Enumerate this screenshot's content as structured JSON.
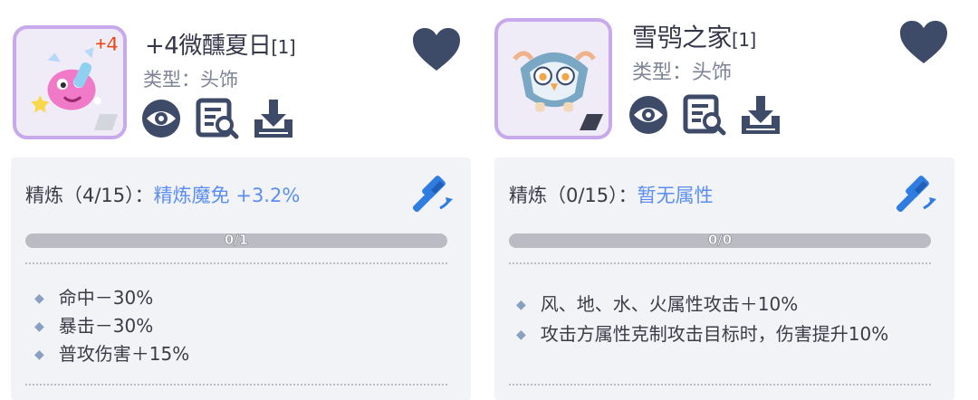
{
  "left": {
    "title": "+4微醺夏日",
    "title_tag": "[1]",
    "plus_badge": "+4",
    "type_line": "类型：头饰",
    "refine_label": "精炼（4/15）：",
    "refine_value": "精炼魔免 +3.2%",
    "progress_text": "0/1",
    "progress_fraction": 0,
    "stats": [
      "命中－30%",
      "暴击－30%",
      "普攻伤害＋15%"
    ],
    "icons": [
      "view-eye-icon",
      "inspect-document-icon",
      "download-icon",
      "heart-icon",
      "hammer-icon"
    ]
  },
  "right": {
    "title": "雪鸮之家",
    "title_tag": "[1]",
    "type_line": "类型：头饰",
    "refine_label": "精炼（0/15）：",
    "refine_value": "暂无属性",
    "progress_text": "0/0",
    "progress_fraction": 0,
    "stats": [
      "风、地、水、火属性攻击＋10%",
      "攻击方属性克制攻击目标时，伤害提升10%"
    ],
    "icons": [
      "view-eye-icon",
      "inspect-document-icon",
      "download-icon",
      "heart-icon",
      "hammer-icon"
    ]
  },
  "colors": {
    "frame_border": "#c8a9ec",
    "icon_navy": "#3d4a68",
    "accent_blue": "#5b8ef0",
    "hammer_blue": "#2f7de0",
    "plus_badge": "#e8471e"
  }
}
